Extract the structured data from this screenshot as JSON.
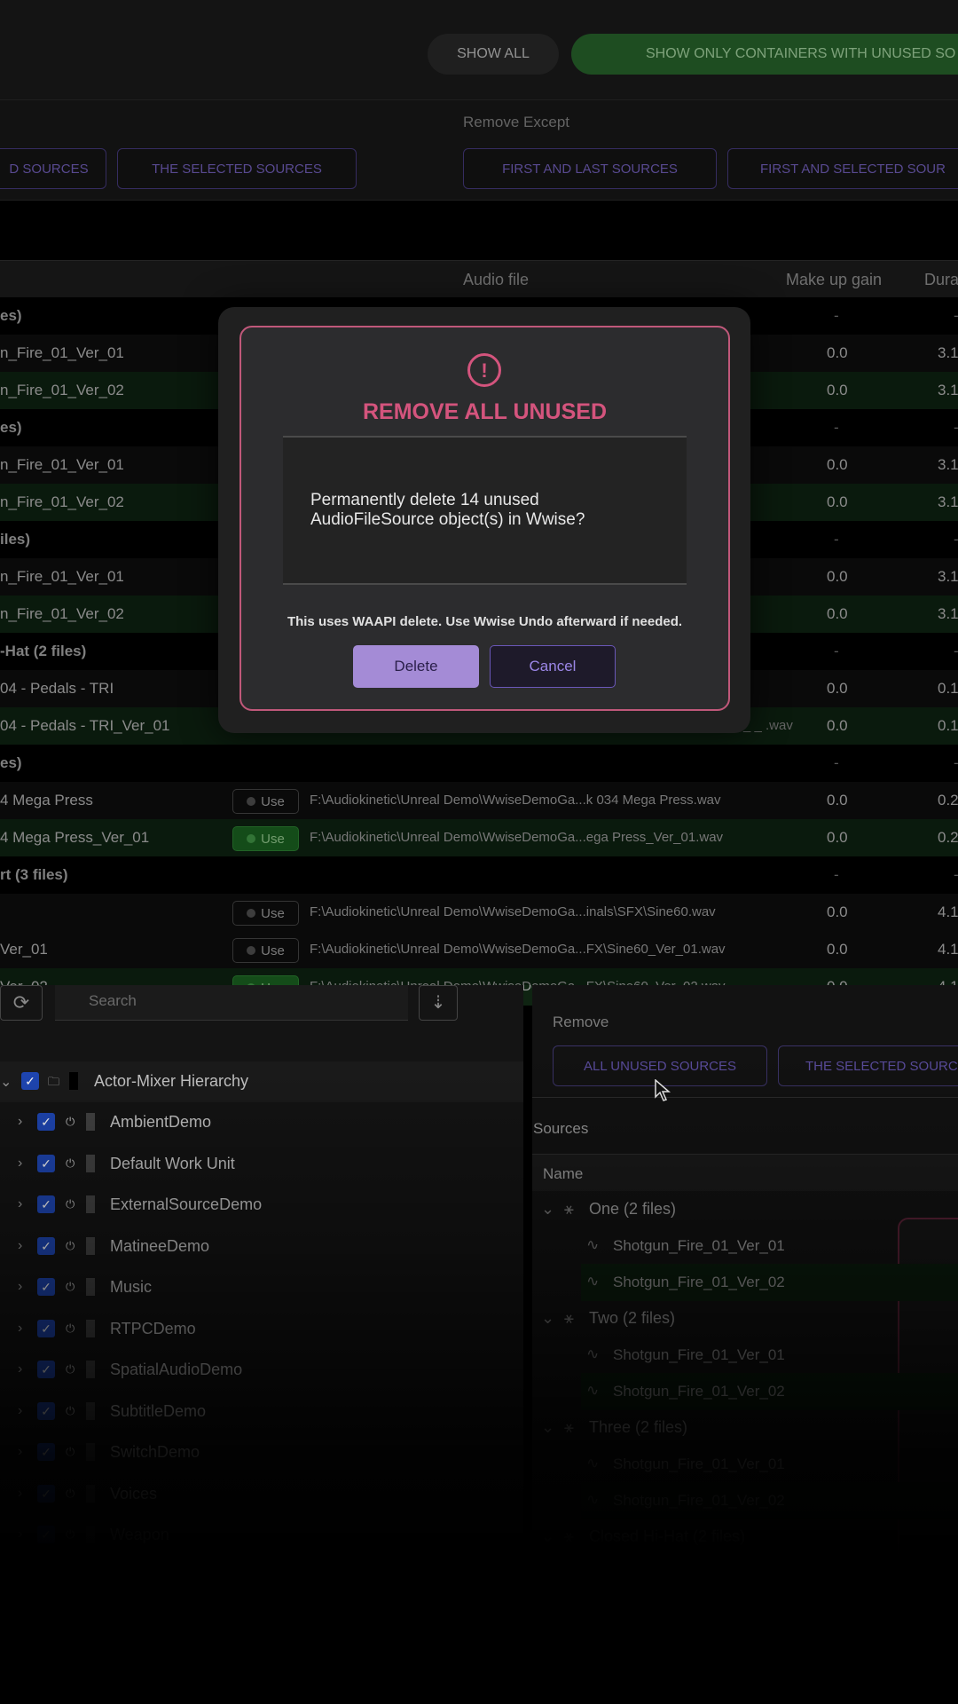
{
  "topbar": {
    "show_all": "SHOW ALL",
    "show_only": "SHOW ONLY CONTAINERS WITH UNUSED SO"
  },
  "removebar": {
    "remove_except_label": "Remove Except",
    "buttons": [
      "D SOURCES",
      "THE SELECTED SOURCES",
      "FIRST AND LAST SOURCES",
      "FIRST AND SELECTED SOUR"
    ]
  },
  "table": {
    "headers": {
      "audio_file": "Audio file",
      "gain": "Make up gain",
      "duration": "Dura"
    },
    "rows": [
      {
        "name": "es)",
        "group": true
      },
      {
        "name": "n_Fire_01_Ver_01",
        "gain": "0.0",
        "dur": "3.1",
        "ext": "v"
      },
      {
        "name": "n_Fire_01_Ver_02",
        "gain": "0.0",
        "dur": "3.1",
        "ext": "v",
        "green": true
      },
      {
        "name": "es)",
        "group": true
      },
      {
        "name": "n_Fire_01_Ver_01",
        "gain": "0.0",
        "dur": "3.1",
        "ext": "v"
      },
      {
        "name": "n_Fire_01_Ver_02",
        "gain": "0.0",
        "dur": "3.1",
        "ext": "v",
        "green": true
      },
      {
        "name": "iles)",
        "group": true
      },
      {
        "name": "n_Fire_01_Ver_01",
        "gain": "0.0",
        "dur": "3.1",
        "ext": "v"
      },
      {
        "name": "n_Fire_01_Ver_02",
        "gain": "0.0",
        "dur": "3.1",
        "ext": "v",
        "green": true
      },
      {
        "name": "-Hat (2 files)",
        "group": true
      },
      {
        "name": "04 - Pedals - TRI",
        "gain": "0.0",
        "dur": "0.1",
        "ext": "v"
      },
      {
        "name": "04 - Pedals - TRI_Ver_01",
        "gain": "0.0",
        "dur": "0.1",
        "ext": "_ _ .wav",
        "green": true
      },
      {
        "name": "es)",
        "group": true
      },
      {
        "name": "4 Mega Press",
        "use": "Use",
        "file": "F:\\Audiokinetic\\Unreal Demo\\WwiseDemoGa...k 034 Mega Press.wav",
        "gain": "0.0",
        "dur": "0.2"
      },
      {
        "name": "4 Mega Press_Ver_01",
        "use": "Use",
        "file": "F:\\Audiokinetic\\Unreal Demo\\WwiseDemoGa...ega Press_Ver_01.wav",
        "gain": "0.0",
        "dur": "0.2",
        "green": true
      },
      {
        "name": "rt (3 files)",
        "group": true
      },
      {
        "name": "",
        "use": "Use",
        "file": "F:\\Audiokinetic\\Unreal Demo\\WwiseDemoGa...inals\\SFX\\Sine60.wav",
        "gain": "0.0",
        "dur": "4.1"
      },
      {
        "name": "Ver_01",
        "use": "Use",
        "file": "F:\\Audiokinetic\\Unreal Demo\\WwiseDemoGa...FX\\Sine60_Ver_01.wav",
        "gain": "0.0",
        "dur": "4.1"
      },
      {
        "name": "Ver_02",
        "use": "Use",
        "file": "F:\\Audiokinetic\\Unreal Demo\\WwiseDemoGa...FX\\Sine60_Ver_02.wav",
        "gain": "0.0",
        "dur": "4.1",
        "green": true
      }
    ]
  },
  "lower_left": {
    "search_placeholder": "Search",
    "root": "Actor-Mixer Hierarchy",
    "items": [
      "AmbientDemo",
      "Default Work Unit",
      "ExternalSourceDemo",
      "MatineeDemo",
      "Music",
      "RTPCDemo",
      "SpatialAudioDemo",
      "SubtitleDemo",
      "SwitchDemo",
      "Voices",
      "Weapon"
    ]
  },
  "lower_right": {
    "remove_label": "Remove",
    "btn_all_unused": "ALL UNUSED SOURCES",
    "btn_selected": "THE SELECTED SOURC",
    "sources_label": "Sources",
    "name_header": "Name",
    "groups": [
      {
        "name": "One (2 files)",
        "files": [
          "Shotgun_Fire_01_Ver_01",
          "Shotgun_Fire_01_Ver_02"
        ]
      },
      {
        "name": "Two (2 files)",
        "files": [
          "Shotgun_Fire_01_Ver_01",
          "Shotgun_Fire_01_Ver_02"
        ]
      },
      {
        "name": "Three (2 files)",
        "files": [
          "Shotgun_Fire_01_Ver_01",
          "Shotgun_Fire_01_Ver_02"
        ]
      },
      {
        "name": "Closed Hi-Hat (2 files)",
        "files": []
      }
    ]
  },
  "modal": {
    "title": "REMOVE ALL UNUSED",
    "icon": "!",
    "message": "Permanently delete 14 unused AudioFileSource object(s) in Wwise?",
    "note": "This uses WAAPI delete. Use Wwise Undo afterward if needed.",
    "delete": "Delete",
    "cancel": "Cancel"
  },
  "colors": {
    "accent_pink": "#d4547d",
    "accent_purple": "#a48bd6",
    "green": "#2a6b2f"
  }
}
